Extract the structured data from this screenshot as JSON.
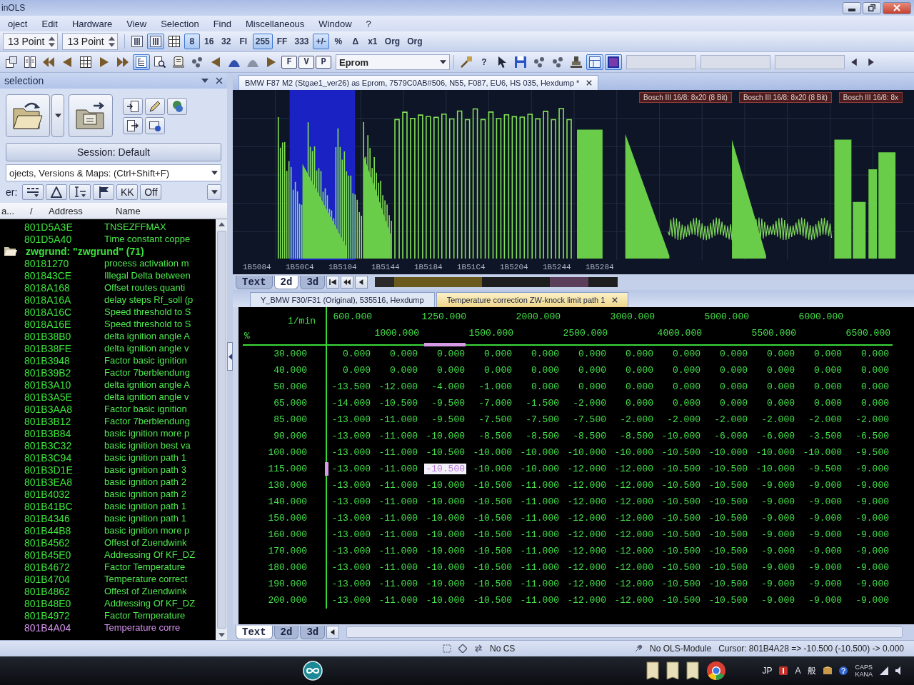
{
  "window": {
    "title": "inOLS"
  },
  "menu": [
    "oject",
    "Edit",
    "Hardware",
    "View",
    "Selection",
    "Find",
    "Miscellaneous",
    "Window",
    "?"
  ],
  "toolbar_1": {
    "point_fields": [
      "13 Point",
      "13 Point"
    ],
    "buttons": [
      {
        "kind": "columns",
        "selected": false
      },
      {
        "kind": "columns",
        "selected": true
      },
      {
        "kind": "grid",
        "selected": false
      },
      {
        "kind": "text",
        "label": "8",
        "selected": true
      },
      {
        "kind": "text",
        "label": "16",
        "selected": false
      },
      {
        "kind": "text",
        "label": "32",
        "selected": false
      },
      {
        "kind": "text",
        "label": "Fl",
        "selected": false
      },
      {
        "kind": "text",
        "label": "255",
        "selected": true
      },
      {
        "kind": "text",
        "label": "FF",
        "selected": false
      },
      {
        "kind": "text",
        "label": "333",
        "selected": false
      },
      {
        "kind": "text",
        "label": "+/-",
        "selected": true
      },
      {
        "kind": "text",
        "label": "%",
        "selected": false
      },
      {
        "kind": "text",
        "label": "Δ",
        "selected": false
      },
      {
        "kind": "text",
        "label": "x1",
        "selected": false
      },
      {
        "kind": "text",
        "label": "Org",
        "selected": false
      },
      {
        "kind": "text",
        "label": "Org",
        "selected": false
      }
    ]
  },
  "toolbar_2": {
    "buttons": [
      {
        "kind": "windows",
        "selected": false
      },
      {
        "kind": "split",
        "selected": false
      },
      {
        "kind": "rewind",
        "selected": false
      },
      {
        "kind": "prev",
        "selected": false
      },
      {
        "kind": "grid",
        "selected": false
      },
      {
        "kind": "next",
        "selected": false
      },
      {
        "kind": "forward",
        "selected": false
      },
      {
        "kind": "tree",
        "selected": true
      },
      {
        "kind": "find",
        "selected": false
      },
      {
        "kind": "scroll",
        "selected": false
      },
      {
        "kind": "dots",
        "selected": false
      },
      {
        "kind": "prev",
        "selected": false
      },
      {
        "kind": "arch",
        "selected": false
      },
      {
        "kind": "arch_flat",
        "selected": false
      },
      {
        "kind": "next",
        "selected": false
      },
      {
        "kind": "text",
        "label": "F",
        "selected": false
      },
      {
        "kind": "text",
        "label": "V",
        "selected": false
      },
      {
        "kind": "text",
        "label": "P",
        "selected": false
      }
    ],
    "dropdown": "Eprom",
    "buttons_right": [
      {
        "kind": "tool",
        "selected": false
      },
      {
        "kind": "text",
        "label": "?",
        "selected": false
      },
      {
        "kind": "pointer",
        "selected": false
      },
      {
        "kind": "save",
        "selected": false
      },
      {
        "kind": "dots",
        "selected": false
      },
      {
        "kind": "dots",
        "selected": false
      },
      {
        "kind": "stamp",
        "selected": false
      },
      {
        "kind": "layout",
        "selected": true
      },
      {
        "kind": "square",
        "selected": true
      }
    ]
  },
  "selection_panel": {
    "title": "selection",
    "session_button": "Session: Default",
    "search_dropdown": "ojects, Versions & Maps: (Ctrl+Shift+F)",
    "filter_label": "er:",
    "filter_buttons": [
      {
        "kind": "bars"
      },
      {
        "kind": "triangle"
      },
      {
        "kind": "cursor"
      },
      {
        "kind": "flag"
      },
      {
        "kind": "text",
        "label": "KK"
      },
      {
        "kind": "text",
        "label": "Off"
      }
    ],
    "columns": [
      "a...",
      "/",
      "Address",
      "Name"
    ],
    "rows": [
      {
        "kind": "map",
        "address": "801D5A3E",
        "name": "TNSEZFFMAX",
        "selected": false
      },
      {
        "kind": "map",
        "address": "801D5A40",
        "name": "Time constant coppe",
        "selected": false
      },
      {
        "kind": "folder",
        "name": "zwgrund: \"zwgrund\" (71)",
        "selected": false,
        "children": [
          {
            "kind": "map",
            "address": "80181270",
            "name": "process activation m",
            "selected": false
          },
          {
            "kind": "map",
            "address": "801843CE",
            "name": "Illegal Delta between",
            "selected": false
          },
          {
            "kind": "map",
            "address": "8018A168",
            "name": "Offset routes quanti",
            "selected": false
          },
          {
            "kind": "map",
            "address": "8018A16A",
            "name": "delay steps Rf_soll (p",
            "selected": false
          },
          {
            "kind": "map",
            "address": "8018A16C",
            "name": "Speed threshold to S",
            "selected": false
          },
          {
            "kind": "map",
            "address": "8018A16E",
            "name": "Speed threshold to S",
            "selected": false
          },
          {
            "kind": "map",
            "address": "801B38B0",
            "name": "delta ignition angle A",
            "selected": false
          },
          {
            "kind": "map",
            "address": "801B38FE",
            "name": "delta ignition angle v",
            "selected": false
          },
          {
            "kind": "map",
            "address": "801B3948",
            "name": "Factor basic ignition",
            "selected": false
          },
          {
            "kind": "map",
            "address": "801B39B2",
            "name": "Factor 7berblendung",
            "selected": false
          },
          {
            "kind": "map",
            "address": "801B3A10",
            "name": "delta ignition angle A",
            "selected": false
          },
          {
            "kind": "map",
            "address": "801B3A5E",
            "name": "delta ignition angle v",
            "selected": false
          },
          {
            "kind": "map",
            "address": "801B3AA8",
            "name": "Factor basic ignition",
            "selected": false
          },
          {
            "kind": "map",
            "address": "801B3B12",
            "name": "Factor 7berblendung",
            "selected": false
          },
          {
            "kind": "map",
            "address": "801B3B84",
            "name": "basic ignition more p",
            "selected": false
          },
          {
            "kind": "map",
            "address": "801B3C32",
            "name": "basic ignition best va",
            "selected": false
          },
          {
            "kind": "map",
            "address": "801B3C94",
            "name": "basic ignition path 1",
            "selected": false
          },
          {
            "kind": "map",
            "address": "801B3D1E",
            "name": "basic ignition path 3",
            "selected": false
          },
          {
            "kind": "map",
            "address": "801B3EA8",
            "name": "basic ignition path 2",
            "selected": false
          },
          {
            "kind": "map",
            "address": "801B4032",
            "name": "basic ignition path 2",
            "selected": false
          },
          {
            "kind": "map",
            "address": "801B41BC",
            "name": "basic ignition path 1",
            "selected": false
          },
          {
            "kind": "map",
            "address": "801B4346",
            "name": "basic ignition path 1",
            "selected": false
          },
          {
            "kind": "map",
            "address": "801B44B8",
            "name": "basic ignition more p",
            "selected": false
          },
          {
            "kind": "map",
            "address": "801B4562",
            "name": "Offest of Zuendwink",
            "selected": false
          },
          {
            "kind": "map",
            "address": "801B45E0",
            "name": "Addressing Of KF_DZ",
            "selected": false
          },
          {
            "kind": "map",
            "address": "801B4672",
            "name": "Factor Temperature",
            "selected": false
          },
          {
            "kind": "map",
            "address": "801B4704",
            "name": "Temperature correct",
            "selected": false
          },
          {
            "kind": "map",
            "address": "801B4862",
            "name": "Offest of Zuendwink",
            "selected": false
          },
          {
            "kind": "map",
            "address": "801B48E0",
            "name": "Addressing Of KF_DZ",
            "selected": false
          },
          {
            "kind": "map",
            "address": "801B4972",
            "name": "Factor Temperature",
            "selected": false
          },
          {
            "kind": "map",
            "address": "801B4A04",
            "name": "Temperature corre",
            "selected": true
          }
        ]
      }
    ]
  },
  "document_tab": {
    "label": "BMW F87 M2 (Stgae1_ver26) as Eprom, 7579C0AB#506, N55, F087, EU6, HS 035, Hexdump *",
    "selected": true
  },
  "graph": {
    "map_labels": [
      "Bosch III 16/8: 8x20 (8 Bit)",
      "Bosch III 16/8: 8x20 (8 Bit)",
      "Bosch III 16/8: 8x"
    ],
    "x_labels": [
      "1B5084",
      "1B50C4",
      "1B5104",
      "1B5144",
      "1B5184",
      "1B51C4",
      "1B5204",
      "1B5244",
      "1B5284"
    ],
    "view_tabs": [
      {
        "label": "Text",
        "selected": false
      },
      {
        "label": "2d",
        "selected": true
      },
      {
        "label": "3d",
        "selected": false
      }
    ]
  },
  "map_tabs": [
    {
      "label": "Y_BMW F30/F31 (Original), 535516, Hexdump",
      "selected": false
    },
    {
      "label": "Temperature correction ZW-knock limit path 1",
      "selected": true
    }
  ],
  "table": {
    "x_unit": "1/min",
    "y_unit": "%",
    "columns": [
      {
        "label": "600.000",
        "selected": false
      },
      {
        "label": "1000.000",
        "selected": false
      },
      {
        "label": "1250.000",
        "selected": true
      },
      {
        "label": "1500.000",
        "selected": false
      },
      {
        "label": "2000.000",
        "selected": false
      },
      {
        "label": "2500.000",
        "selected": false
      },
      {
        "label": "3000.000",
        "selected": false
      },
      {
        "label": "4000.000",
        "selected": false
      },
      {
        "label": "5000.000",
        "selected": false
      },
      {
        "label": "5500.000",
        "selected": false
      },
      {
        "label": "6000.000",
        "selected": false
      },
      {
        "label": "6500.000",
        "selected": false
      }
    ],
    "rows": [
      {
        "label": "30.000",
        "selected": false,
        "values": [
          "0.000",
          "0.000",
          "0.000",
          "0.000",
          "0.000",
          "0.000",
          "0.000",
          "0.000",
          "0.000",
          "0.000",
          "0.000",
          "0.000"
        ]
      },
      {
        "label": "40.000",
        "selected": false,
        "values": [
          "0.000",
          "0.000",
          "0.000",
          "0.000",
          "0.000",
          "0.000",
          "0.000",
          "0.000",
          "0.000",
          "0.000",
          "0.000",
          "0.000"
        ]
      },
      {
        "label": "50.000",
        "selected": false,
        "values": [
          "-13.500",
          "-12.000",
          "-4.000",
          "-1.000",
          "0.000",
          "0.000",
          "0.000",
          "0.000",
          "0.000",
          "0.000",
          "0.000",
          "0.000"
        ]
      },
      {
        "label": "65.000",
        "selected": false,
        "values": [
          "-14.000",
          "-10.500",
          "-9.500",
          "-7.000",
          "-1.500",
          "-2.000",
          "0.000",
          "0.000",
          "0.000",
          "0.000",
          "0.000",
          "0.000"
        ]
      },
      {
        "label": "85.000",
        "selected": false,
        "values": [
          "-13.000",
          "-11.000",
          "-9.500",
          "-7.500",
          "-7.500",
          "-7.500",
          "-2.000",
          "-2.000",
          "-2.000",
          "-2.000",
          "-2.000",
          "-2.000"
        ]
      },
      {
        "label": "90.000",
        "selected": false,
        "values": [
          "-13.000",
          "-11.000",
          "-10.000",
          "-8.500",
          "-8.500",
          "-8.500",
          "-8.500",
          "-10.000",
          "-6.000",
          "-6.000",
          "-3.500",
          "-6.500"
        ]
      },
      {
        "label": "100.000",
        "selected": false,
        "values": [
          "-13.000",
          "-11.000",
          "-10.500",
          "-10.000",
          "-10.000",
          "-10.000",
          "-10.000",
          "-10.500",
          "-10.000",
          "-10.000",
          "-10.000",
          "-9.500"
        ]
      },
      {
        "label": "115.000",
        "selected": true,
        "values": [
          "-13.000",
          "-11.000",
          "-10.500",
          "-10.000",
          "-10.000",
          "-12.000",
          "-12.000",
          "-10.500",
          "-10.500",
          "-10.000",
          "-9.500",
          "-9.000"
        ]
      },
      {
        "label": "130.000",
        "selected": false,
        "values": [
          "-13.000",
          "-11.000",
          "-10.000",
          "-10.500",
          "-11.000",
          "-12.000",
          "-12.000",
          "-10.500",
          "-10.500",
          "-9.000",
          "-9.000",
          "-9.000"
        ]
      },
      {
        "label": "140.000",
        "selected": false,
        "values": [
          "-13.000",
          "-11.000",
          "-10.000",
          "-10.500",
          "-11.000",
          "-12.000",
          "-12.000",
          "-10.500",
          "-10.500",
          "-9.000",
          "-9.000",
          "-9.000"
        ]
      },
      {
        "label": "150.000",
        "selected": false,
        "values": [
          "-13.000",
          "-11.000",
          "-10.000",
          "-10.500",
          "-11.000",
          "-12.000",
          "-12.000",
          "-10.500",
          "-10.500",
          "-9.000",
          "-9.000",
          "-9.000"
        ]
      },
      {
        "label": "160.000",
        "selected": false,
        "values": [
          "-13.000",
          "-11.000",
          "-10.000",
          "-10.500",
          "-11.000",
          "-12.000",
          "-12.000",
          "-10.500",
          "-10.500",
          "-9.000",
          "-9.000",
          "-9.000"
        ]
      },
      {
        "label": "170.000",
        "selected": false,
        "values": [
          "-13.000",
          "-11.000",
          "-10.000",
          "-10.500",
          "-11.000",
          "-12.000",
          "-12.000",
          "-10.500",
          "-10.500",
          "-9.000",
          "-9.000",
          "-9.000"
        ]
      },
      {
        "label": "180.000",
        "selected": false,
        "values": [
          "-13.000",
          "-11.000",
          "-10.000",
          "-10.500",
          "-11.000",
          "-12.000",
          "-12.000",
          "-10.500",
          "-10.500",
          "-9.000",
          "-9.000",
          "-9.000"
        ]
      },
      {
        "label": "190.000",
        "selected": false,
        "values": [
          "-13.000",
          "-11.000",
          "-10.000",
          "-10.500",
          "-11.000",
          "-12.000",
          "-12.000",
          "-10.500",
          "-10.500",
          "-9.000",
          "-9.000",
          "-9.000"
        ]
      },
      {
        "label": "200.000",
        "selected": false,
        "values": [
          "-13.000",
          "-11.000",
          "-10.000",
          "-10.500",
          "-11.000",
          "-12.000",
          "-12.000",
          "-10.500",
          "-10.500",
          "-9.000",
          "-9.000",
          "-9.000"
        ]
      }
    ],
    "view_tabs": [
      {
        "label": "Text",
        "selected": true
      },
      {
        "label": "2d",
        "selected": false
      },
      {
        "label": "3d",
        "selected": false
      }
    ]
  },
  "status_bar": {
    "panes": [
      "No CS",
      "No OLS-Module",
      "Cursor: 801B4A28 => -10.500 (-10.500) -> 0.000"
    ]
  },
  "taskbar": {
    "tray": [
      "JP",
      "A",
      "般",
      "CAPS",
      "KANA"
    ]
  }
}
